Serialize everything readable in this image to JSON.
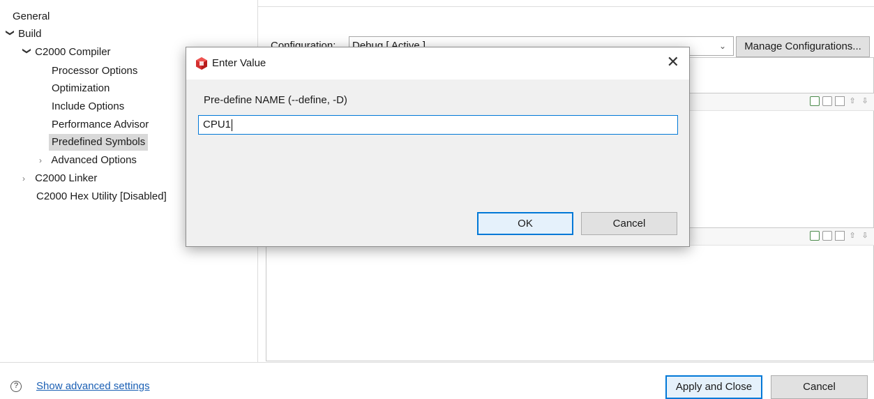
{
  "tree": {
    "general": "General",
    "build": "Build",
    "compiler": "C2000 Compiler",
    "processor_options": "Processor Options",
    "optimization": "Optimization",
    "include_options": "Include Options",
    "performance_advisor": "Performance Advisor",
    "predefined_symbols": "Predefined Symbols",
    "advanced_options": "Advanced Options",
    "linker": "C2000 Linker",
    "hex_utility": "C2000 Hex Utility  [Disabled]"
  },
  "config": {
    "label": "Configuration:",
    "value": "Debug  [ Active ]",
    "manage_button": "Manage Configurations..."
  },
  "dialog": {
    "title": "Enter Value",
    "close_glyph": "✕",
    "prompt": "Pre-define NAME (--define, -D)",
    "input_value": "CPU1",
    "ok": "OK",
    "cancel": "Cancel"
  },
  "footer": {
    "help_glyph": "?",
    "advanced_link": "Show advanced settings",
    "apply_close": "Apply and Close",
    "cancel": "Cancel"
  },
  "icons": {
    "expanded": "chevron-down-icon",
    "collapsed": "chevron-right-icon",
    "dialog": "ccs-cube-icon",
    "help": "help-circle-icon"
  },
  "colors": {
    "accent": "#0078d7",
    "link": "#1a5fb4",
    "selection": "#d9d9d9",
    "dialog_icon": "#d32f2f"
  }
}
